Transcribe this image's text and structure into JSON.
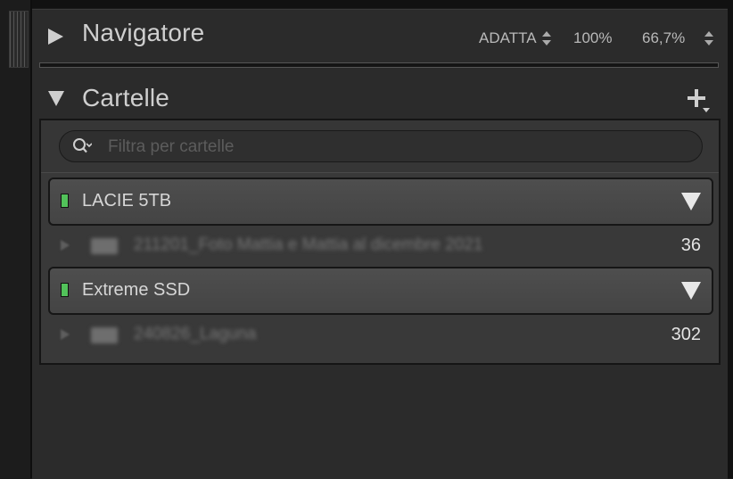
{
  "navigator": {
    "title": "Navigatore",
    "zoom_fit": "ADATTA",
    "zoom_100": "100%",
    "zoom_custom": "66,7%"
  },
  "folders_panel": {
    "title": "Cartelle",
    "search": {
      "placeholder": "Filtra per cartelle",
      "value": ""
    },
    "volumes": [
      {
        "name": "LACIE 5TB",
        "status_color": "#52c25a",
        "folders": [
          {
            "name": "211201_Foto Mattia e Mattia al dicembre 2021",
            "count": "36"
          }
        ]
      },
      {
        "name": "Extreme SSD",
        "status_color": "#52c25a",
        "folders": [
          {
            "name": "240826_Laguna",
            "count": "302"
          }
        ]
      }
    ]
  }
}
